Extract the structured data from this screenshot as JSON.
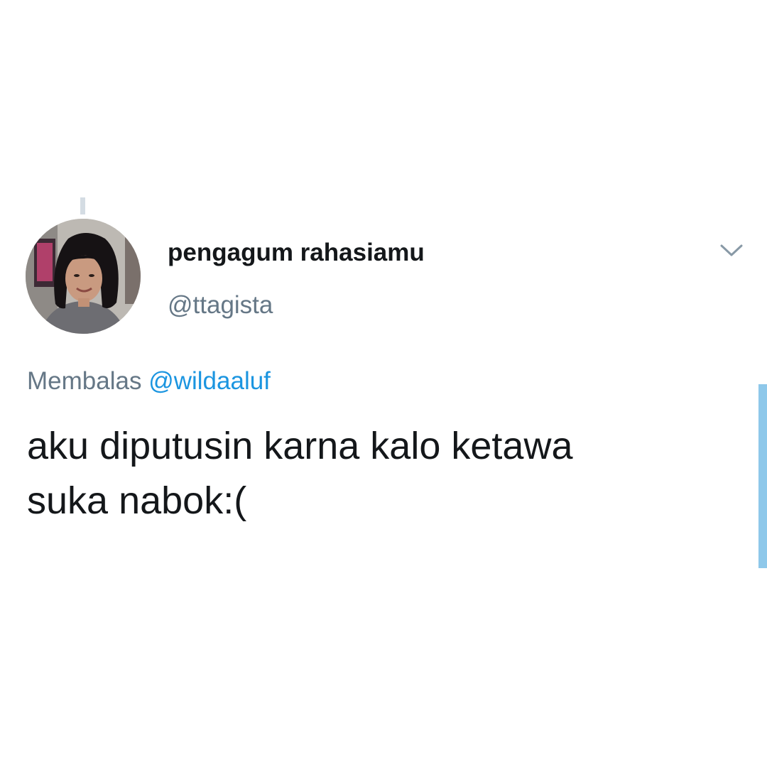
{
  "tweet": {
    "author": {
      "display_name": "pengagum rahasiamu",
      "handle": "@ttagista",
      "avatar_icon": "profile-photo"
    },
    "menu_icon": "chevron-down-icon",
    "reply": {
      "prefix": "Membalas",
      "mention": "@wildaaluf"
    },
    "text_lines": [
      "aku diputusin karna kalo ketawa",
      "suka nabok:("
    ]
  },
  "colors": {
    "name": "#14171a",
    "secondary": "#657786",
    "link": "#1b95e0",
    "thread_line": "#d4dce3",
    "scroll_indicator": "#8ec8ea"
  }
}
